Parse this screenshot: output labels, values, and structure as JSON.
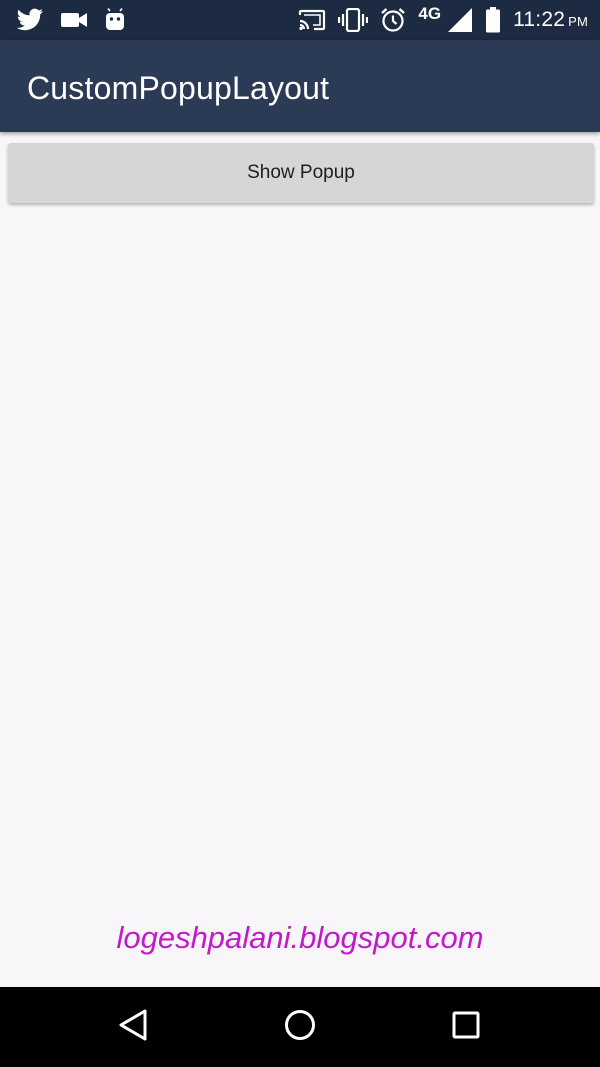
{
  "status_bar": {
    "left_icons": [
      "twitter-icon",
      "video-camera-icon",
      "android-icon"
    ],
    "right_icons": [
      "cast-icon",
      "vibrate-icon",
      "alarm-icon",
      "signal-icon",
      "battery-icon"
    ],
    "network": "4G",
    "time": "11:22",
    "ampm": "PM"
  },
  "app_bar": {
    "title": "CustomPopupLayout"
  },
  "main": {
    "button_label": "Show Popup"
  },
  "watermark": "logeshpalani.blogspot.com",
  "nav_bar": {
    "icons": [
      "back-icon",
      "home-icon",
      "recents-icon"
    ]
  },
  "colors": {
    "status_bar": "#1c2b41",
    "app_bar": "#2b3a55",
    "background": "#f8f6f9",
    "button": "#d6d5d7",
    "watermark": "#c21ac9",
    "nav_bar": "#000000"
  }
}
